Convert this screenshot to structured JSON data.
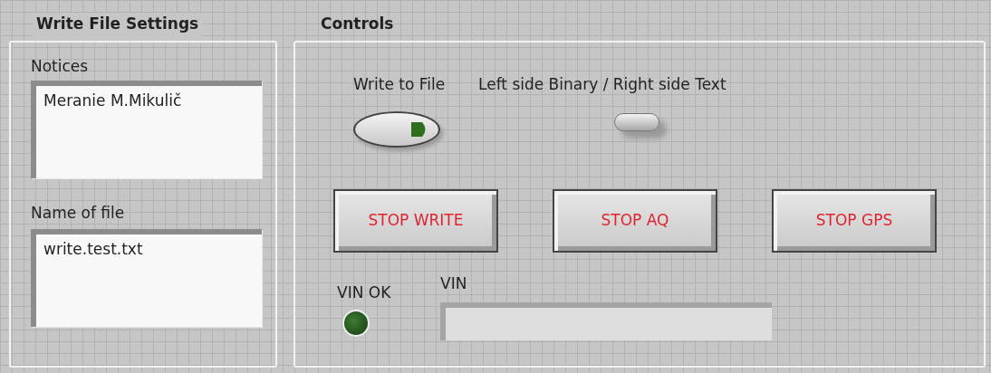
{
  "write_file_settings": {
    "title": "Write File Settings",
    "notices": {
      "label": "Notices",
      "value": "Meranie M.Mikulič"
    },
    "file_name": {
      "label": "Name of file",
      "value": "write.test.txt"
    }
  },
  "controls": {
    "title": "Controls",
    "write_to_file": {
      "label": "Write to File",
      "on": true
    },
    "format_switch": {
      "label": "Left side Binary / Right side Text",
      "on": false
    },
    "buttons": [
      "STOP WRITE",
      "STOP AQ",
      "STOP GPS"
    ],
    "vin_ok": {
      "label": "VIN OK",
      "on": false
    },
    "vin": {
      "label": "VIN"
    }
  }
}
